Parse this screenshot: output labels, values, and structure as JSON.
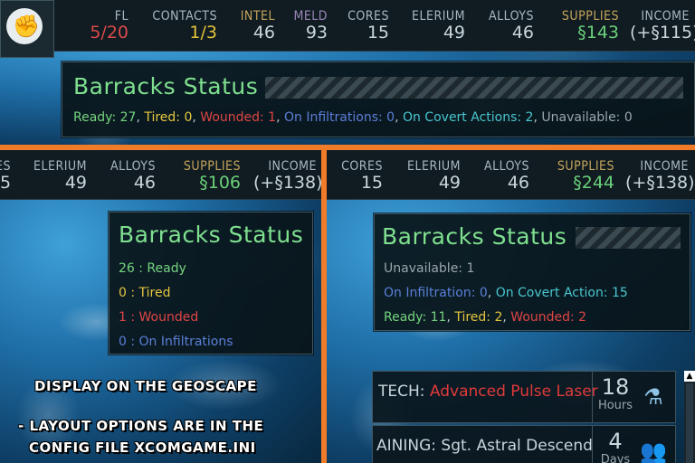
{
  "top": {
    "resources": [
      {
        "label": "FL",
        "value": "5/20",
        "label_class": "",
        "value_class": "red"
      },
      {
        "label": "CONTACTS",
        "value": "1/3",
        "label_class": "gold",
        "value_class": "yellow"
      },
      {
        "label": "INTEL",
        "value": "46",
        "label_class": "gold",
        "value_class": ""
      },
      {
        "label": "MELD",
        "value": "93",
        "label_class": "purple",
        "value_class": ""
      },
      {
        "label": "CORES",
        "value": "15",
        "label_class": "",
        "value_class": ""
      },
      {
        "label": "ELERIUM",
        "value": "49",
        "label_class": "",
        "value_class": ""
      },
      {
        "label": "ALLOYS",
        "value": "46",
        "label_class": "",
        "value_class": ""
      },
      {
        "label": "SUPPLIES",
        "value": "§143",
        "label_class": "gold",
        "value_class": "green"
      },
      {
        "label": "INCOME",
        "value": "(+§115)",
        "label_class": "",
        "value_class": ""
      }
    ],
    "barracks": {
      "title": "Barracks Status",
      "ready": "Ready: 27",
      "tired": "Tired: 0",
      "wounded": "Wounded: 1",
      "infil": "On Infiltrations: 0",
      "covert": "On Covert Actions: 2",
      "unavail": "Unavailable: 0"
    }
  },
  "left": {
    "resources": [
      {
        "label": "ES",
        "value": "5",
        "label_class": "",
        "value_class": ""
      },
      {
        "label": "ELERIUM",
        "value": "49",
        "label_class": "",
        "value_class": ""
      },
      {
        "label": "ALLOYS",
        "value": "46",
        "label_class": "",
        "value_class": ""
      },
      {
        "label": "SUPPLIES",
        "value": "§106",
        "label_class": "gold",
        "value_class": "green"
      },
      {
        "label": "INCOME",
        "value": "(+§138)",
        "label_class": "",
        "value_class": ""
      }
    ],
    "barracks": {
      "title": "Barracks Status",
      "ready": "26 : Ready",
      "tired": "0 : Tired",
      "wounded": "1 : Wounded",
      "infil": "0 : On Infiltrations"
    },
    "caption_1": "DISPLAY ON THE GEOSCAPE",
    "caption_2": "- LAYOUT OPTIONS ARE IN THE",
    "caption_3": "CONFIG FILE XCOMGAME.INI"
  },
  "right": {
    "resources": [
      {
        "label": "CORES",
        "value": "15",
        "label_class": "",
        "value_class": ""
      },
      {
        "label": "ELERIUM",
        "value": "49",
        "label_class": "",
        "value_class": ""
      },
      {
        "label": "ALLOYS",
        "value": "46",
        "label_class": "",
        "value_class": ""
      },
      {
        "label": "SUPPLIES",
        "value": "§244",
        "label_class": "gold",
        "value_class": "green"
      },
      {
        "label": "INCOME",
        "value": "(+§138)",
        "label_class": "",
        "value_class": ""
      }
    ],
    "barracks": {
      "title": "Barracks Status",
      "unavail": "Unavailable: 1",
      "infil": "On Infiltration: 0",
      "covert": "On Covert Action: 15",
      "ready": "Ready: 11",
      "tired": "Tired: 2",
      "wounded": "Wounded: 2"
    },
    "tech": {
      "label": "TECH:",
      "name": "Advanced Pulse Laser",
      "num": "18",
      "unit": "Hours",
      "icon": "flask-icon"
    },
    "training": {
      "label": "AINING:",
      "name": "Sgt. Astral Descend",
      "num": "4",
      "unit": "Days",
      "icon": "soldiers-icon"
    }
  }
}
